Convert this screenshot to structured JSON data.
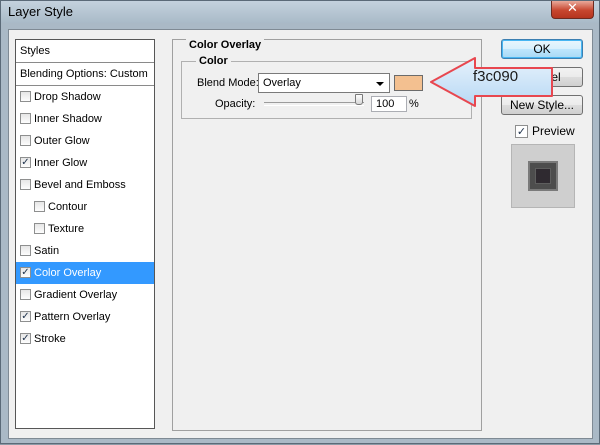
{
  "window": {
    "title": "Layer Style",
    "close_glyph": "✕"
  },
  "stylelist": {
    "header": "Styles",
    "blending": "Blending Options: Custom",
    "items": [
      {
        "label": "Drop Shadow",
        "checked": false,
        "sub": false,
        "selected": false
      },
      {
        "label": "Inner Shadow",
        "checked": false,
        "sub": false,
        "selected": false
      },
      {
        "label": "Outer Glow",
        "checked": false,
        "sub": false,
        "selected": false
      },
      {
        "label": "Inner Glow",
        "checked": true,
        "sub": false,
        "selected": false
      },
      {
        "label": "Bevel and Emboss",
        "checked": false,
        "sub": false,
        "selected": false
      },
      {
        "label": "Contour",
        "checked": false,
        "sub": true,
        "selected": false
      },
      {
        "label": "Texture",
        "checked": false,
        "sub": true,
        "selected": false
      },
      {
        "label": "Satin",
        "checked": false,
        "sub": false,
        "selected": false
      },
      {
        "label": "Color Overlay",
        "checked": true,
        "sub": false,
        "selected": true
      },
      {
        "label": "Gradient Overlay",
        "checked": false,
        "sub": false,
        "selected": false
      },
      {
        "label": "Pattern Overlay",
        "checked": true,
        "sub": false,
        "selected": false
      },
      {
        "label": "Stroke",
        "checked": true,
        "sub": false,
        "selected": false
      }
    ]
  },
  "panel": {
    "title": "Color Overlay",
    "group_title": "Color",
    "blend_mode_label": "Blend Mode:",
    "blend_mode_value": "Overlay",
    "opacity_label": "Opacity:",
    "opacity_value": "100",
    "opacity_unit": "%",
    "opacity_fraction": 1.0,
    "swatch_color": "#f3c090"
  },
  "buttons": {
    "ok": "OK",
    "cancel": "Cancel",
    "new_style": "New Style..."
  },
  "preview": {
    "label": "Preview",
    "checked": true
  },
  "annotation": {
    "text": "f3c090",
    "arrow_color": "#e8474f",
    "fill_color": "#c8e2f8"
  },
  "check_glyph": "✓"
}
